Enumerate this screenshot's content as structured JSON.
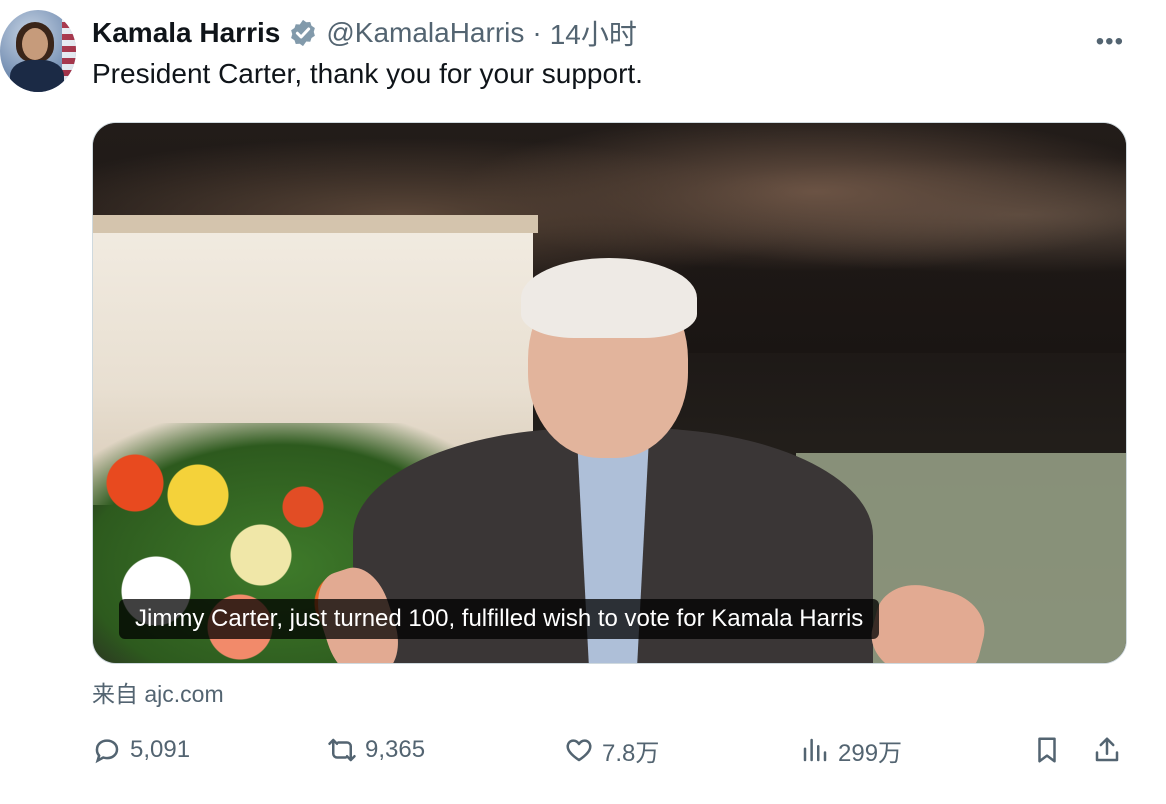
{
  "tweet": {
    "author_name": "Kamala Harris",
    "handle": "@KamalaHarris",
    "separator": "·",
    "time": "14小时",
    "more": "•••",
    "text": "President Carter, thank you for your support.",
    "media": {
      "caption": "Jimmy Carter, just turned 100, fulfilled wish to vote for Kamala Harris"
    },
    "source": "来自 ajc.com"
  },
  "actions": {
    "replies": "5,091",
    "retweets": "9,365",
    "likes": "7.8万",
    "views": "299万"
  },
  "colors": {
    "verified": "#829aab",
    "muted_text": "#536471",
    "main_text": "#0f1419"
  }
}
